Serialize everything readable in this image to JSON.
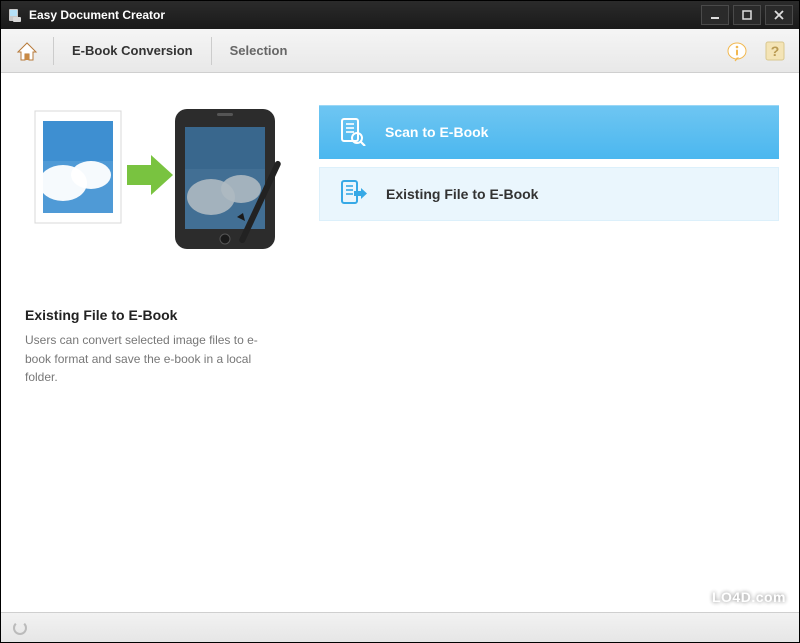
{
  "app": {
    "title": "Easy Document Creator"
  },
  "breadcrumb": {
    "section": "E-Book Conversion",
    "sub": "Selection"
  },
  "options": [
    {
      "label": "Scan to E-Book",
      "selected": true
    },
    {
      "label": "Existing File to E-Book",
      "selected": false
    }
  ],
  "panel": {
    "title": "Existing File to E-Book",
    "description": "Users can convert selected image files to e-book format and save the e-book in a local folder."
  },
  "watermark": "LO4D.com"
}
